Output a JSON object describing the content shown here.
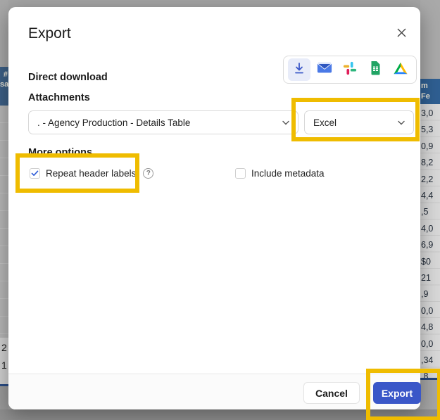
{
  "dialog": {
    "title": "Export",
    "direct_download_label": "Direct download",
    "attachments_label": "Attachments",
    "more_options_label": "More options",
    "attachment_source_value": ". - Agency Production - Details Table",
    "attachment_format_value": "Excel",
    "options": [
      {
        "label": "Repeat header labels",
        "checked": true,
        "has_help": true
      },
      {
        "label": "Include metadata",
        "checked": false,
        "has_help": false
      }
    ],
    "footer": {
      "cancel_label": "Cancel",
      "export_label": "Export"
    }
  },
  "background_table": {
    "left_header_lines": [
      "#",
      "sa"
    ],
    "left_cell_fragments": [
      "2",
      "1"
    ],
    "right_header_lines": [
      "m",
      "Fe"
    ],
    "right_cell_fragments": [
      "3,0",
      "5,3",
      "0,9",
      "8,2",
      "2,2",
      "4,4",
      ",5",
      "4,0",
      "6,9",
      "$0",
      "21",
      ",9",
      "0,0",
      "4,8",
      "0,0",
      ",34",
      ",8"
    ]
  },
  "annotation": {
    "highlight_color": "#EFBC00"
  },
  "colors": {
    "accent_blue": "#3A57C8",
    "table_header_blue": "#2F5F92",
    "check_blue": "#2D5BD7",
    "active_slot_bg": "#E8ECF9"
  }
}
